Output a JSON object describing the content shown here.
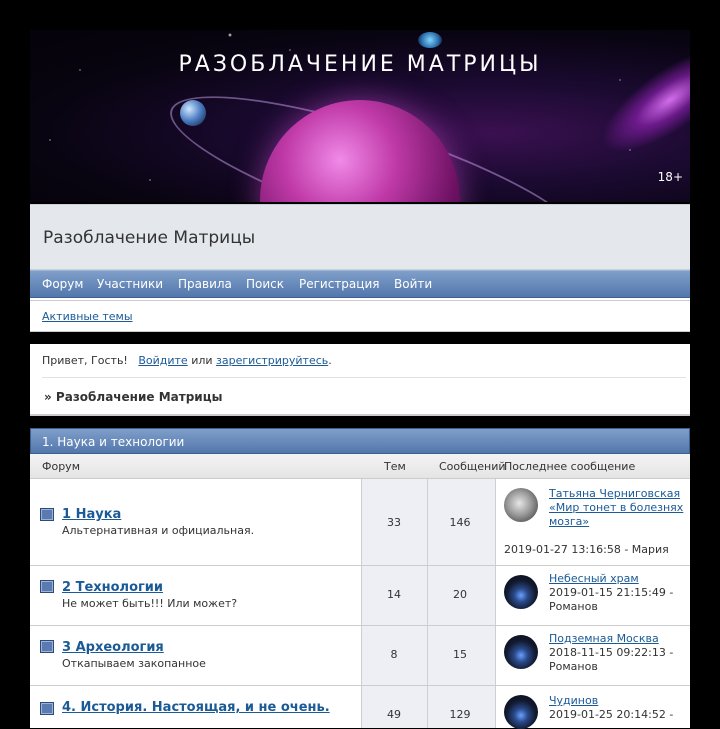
{
  "banner": {
    "title": "РАЗОБЛАЧЕНИЕ МАТРИЦЫ",
    "age": "18+"
  },
  "header": {
    "site_title": "Разоблачение Матрицы",
    "nav": [
      "Форум",
      "Участники",
      "Правила",
      "Поиск",
      "Регистрация",
      "Войти"
    ],
    "subnav_link": "Активные темы"
  },
  "greeting": {
    "prefix": "Привет, Гость!",
    "login": "Войдите",
    "or": "или",
    "register": "зарегистрируйтесь",
    "dot": ".",
    "breadcrumb": "» Разоблачение Матрицы"
  },
  "category": {
    "title": "1. Наука и технологии",
    "headers": {
      "forum": "Форум",
      "topics": "Тем",
      "posts": "Сообщений",
      "last": "Последнее сообщение"
    },
    "rows": [
      {
        "name": "1 Наука",
        "desc": "Альтернативная и официальная.",
        "topics": "33",
        "posts": "146",
        "last_title": "Татьяна Черниговская «Мир тонет в болезнях мозга»",
        "last_meta": "2019-01-27 13:16:58 - Мария",
        "avatar": "cat-avatar"
      },
      {
        "name": "2 Технологии",
        "desc": "Не может быть!!! Или может?",
        "topics": "14",
        "posts": "20",
        "last_title": "Небесный храм",
        "last_meta": "2019-01-15 21:15:49 - Романов",
        "avatar": "hood-avatar"
      },
      {
        "name": "3 Археология",
        "desc": "Откапываем закопанное",
        "topics": "8",
        "posts": "15",
        "last_title": "Подземная Москва",
        "last_meta": "2018-11-15 09:22:13 - Романов",
        "avatar": "hood-avatar"
      },
      {
        "name": "4. История. Настоящая, и не очень.",
        "desc": "",
        "topics": "49",
        "posts": "129",
        "last_title": "Чудинов",
        "last_meta": "2019-01-25 20:14:52 -",
        "avatar": "hood-avatar"
      }
    ]
  }
}
